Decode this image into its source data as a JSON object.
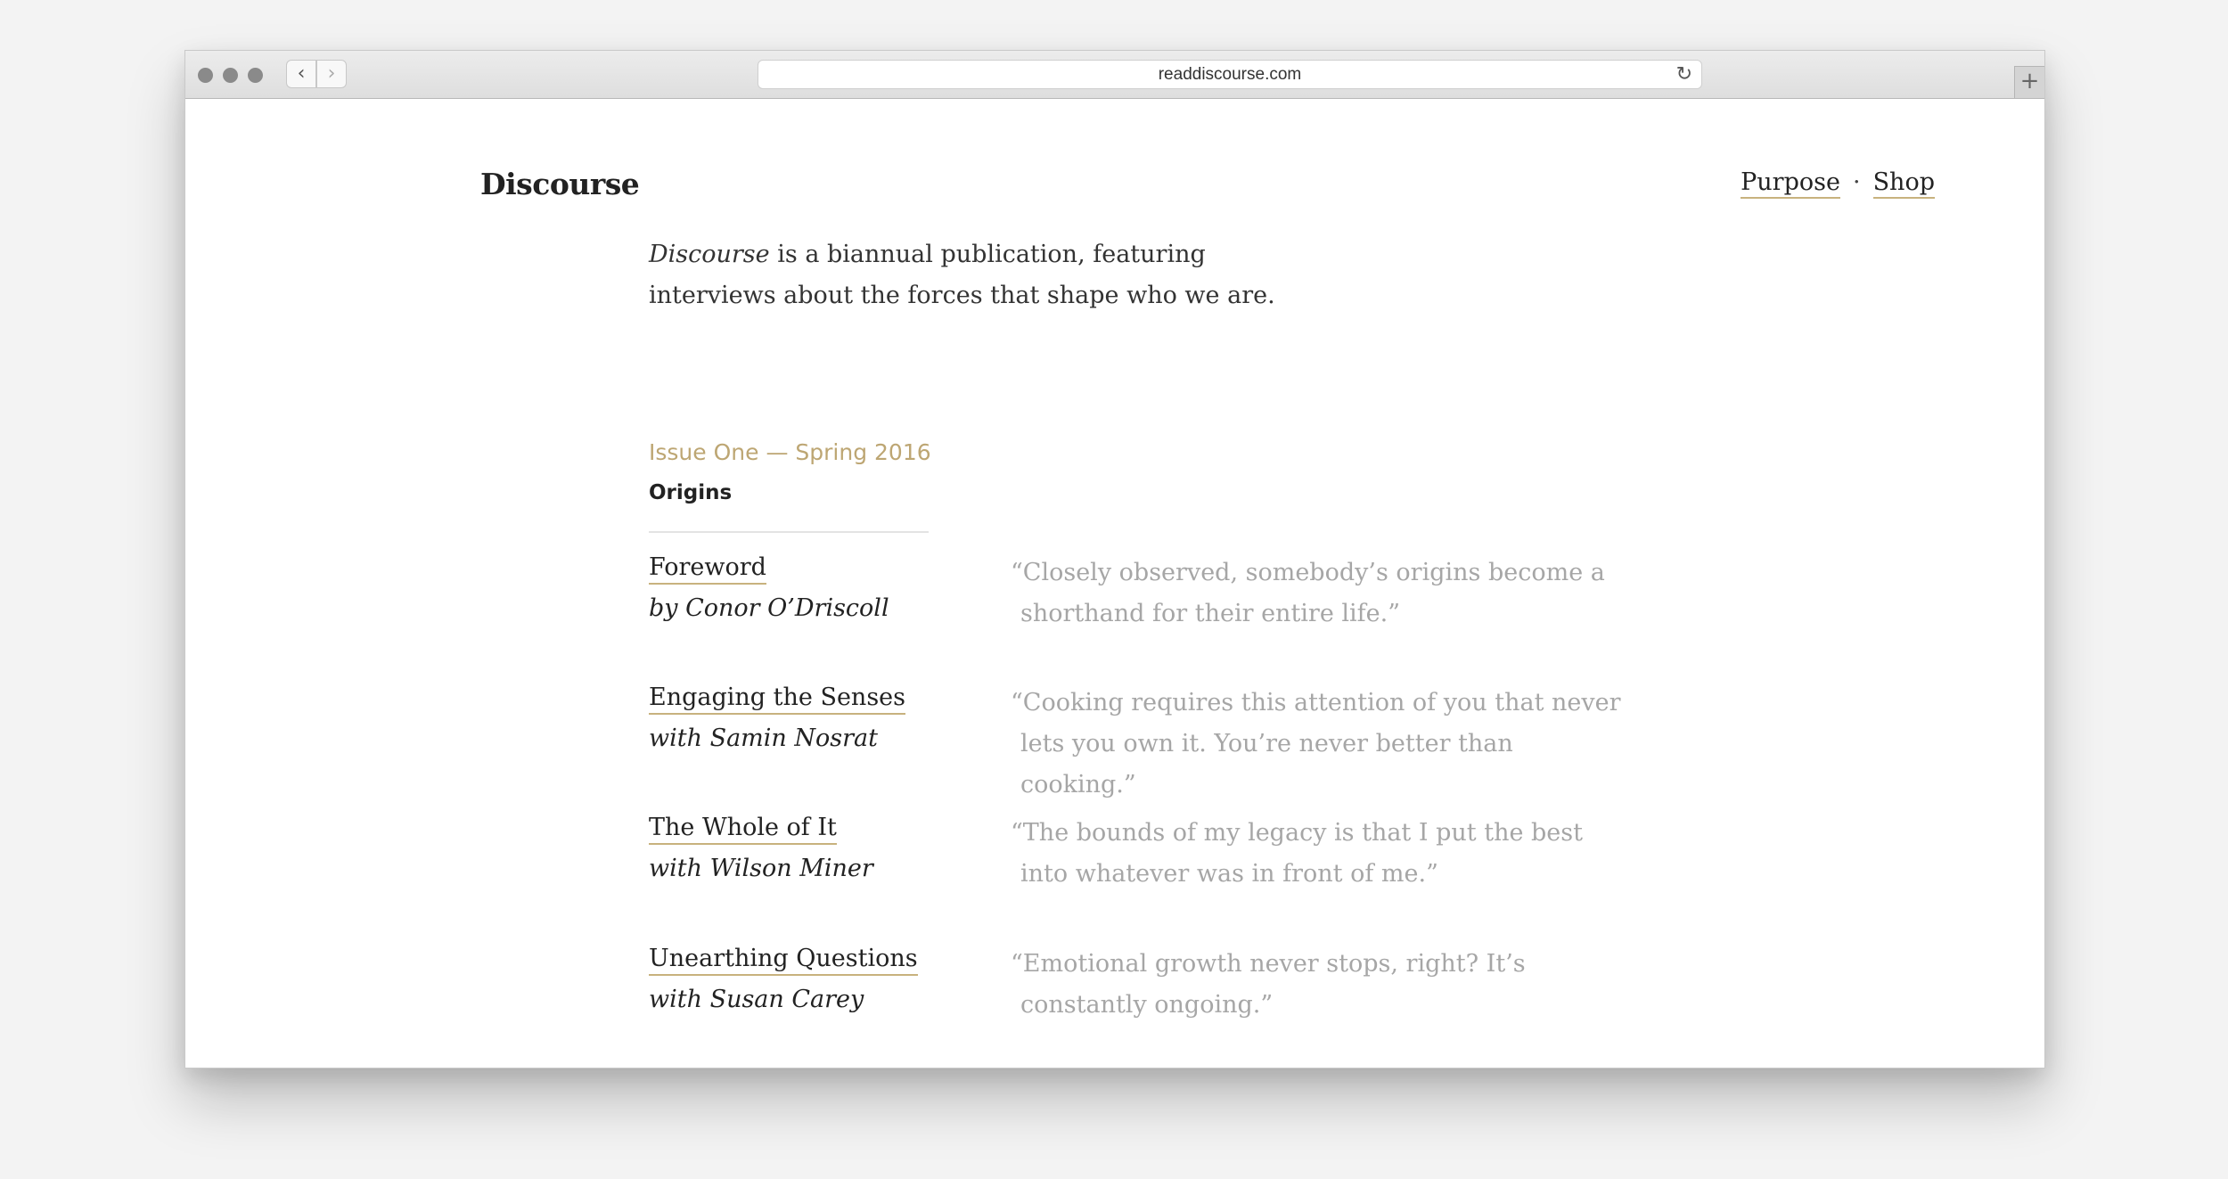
{
  "browser": {
    "url": "readdiscourse.com"
  },
  "site": {
    "logo": "Discourse",
    "nav": {
      "purpose": "Purpose",
      "separator": "·",
      "shop": "Shop"
    },
    "intro": {
      "publication_name": "Discourse",
      "text": " is a biannual publication, featuring interviews about the forces that shape who we are."
    }
  },
  "issue": {
    "label": "Issue One — Spring 2016",
    "title": "Origins",
    "entries": [
      {
        "title": "Foreword",
        "byline": "by Conor O’Driscoll",
        "quote": "“Closely observed, somebody’s origins become a shorthand for their entire life.”"
      },
      {
        "title": "Engaging the Senses",
        "byline": "with Samin Nosrat",
        "quote": "“Cooking requires this attention of you that never lets you own it. You’re never better than cooking.”"
      },
      {
        "title": "The Whole of It",
        "byline": "with Wilson Miner",
        "quote": "“The bounds of my legacy is that I put the best into whatever was in front of me.”"
      },
      {
        "title": "Unearthing Questions",
        "byline": "with Susan Carey",
        "quote": "“Emotional growth never stops, right? It’s constantly ongoing.”"
      }
    ]
  },
  "icons": {
    "back": "chevron-left-icon",
    "forward": "chevron-right-icon",
    "reload": "reload-icon",
    "new_tab": "plus-icon"
  },
  "colors": {
    "accent": "#bda673",
    "underline": "#c8b27e",
    "text": "#222222",
    "quote": "#a6a6a6"
  }
}
